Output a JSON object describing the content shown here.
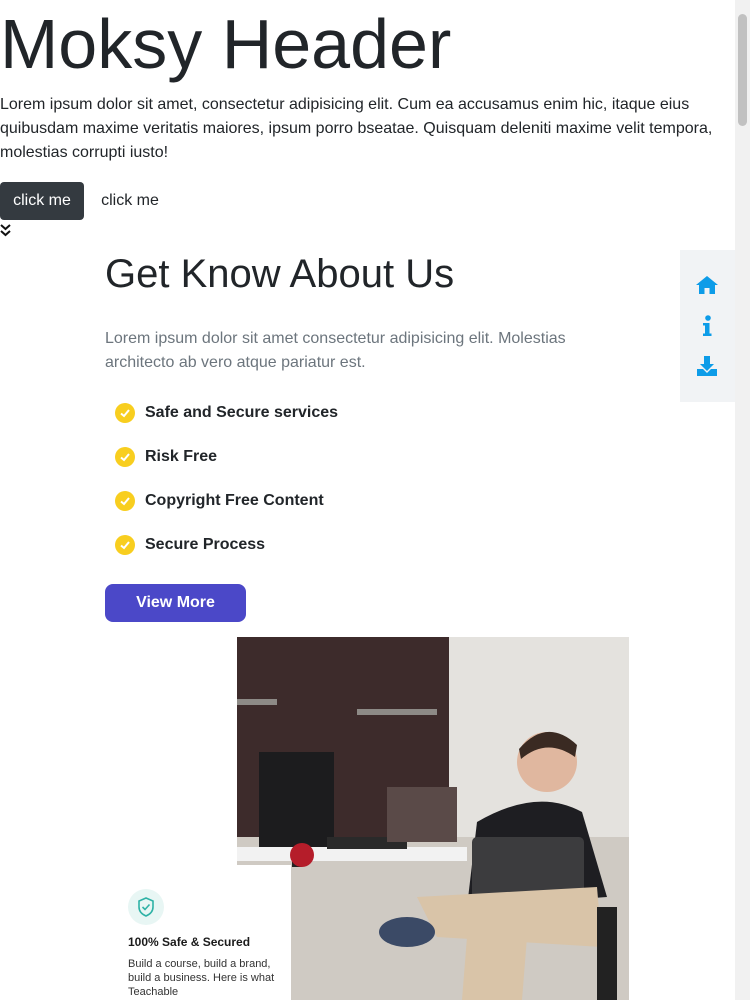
{
  "header": {
    "title": "Moksy Header",
    "text": "Lorem ipsum dolor sit amet, consectetur adipisicing elit. Cum ea accusamus enim hic, itaque eius quibusdam maxime veritatis maiores, ipsum porro bseatae. Quisquam deleniti maxime velit tempora, molestias corrupti iusto!",
    "primary_button": "click me",
    "secondary_button": "click me"
  },
  "about": {
    "title": "Get Know About Us",
    "text": "Lorem ipsum dolor sit amet consectetur adipisicing elit. Molestias architecto ab vero atque pariatur est.",
    "features": [
      "Safe and Secure services",
      "Risk Free",
      "Copyright Free Content",
      "Secure Process"
    ],
    "cta": "View More"
  },
  "card": {
    "title": "100% Safe & Secured",
    "text": "Build a course, build a brand, build a business. Here is what Teachable"
  },
  "side_nav": {
    "items": [
      "home-icon",
      "info-icon",
      "download-icon"
    ]
  },
  "colors": {
    "accent": "#4b48c8",
    "check": "#f8ce1f",
    "nav_icon": "#0d9ce8",
    "dark_button": "#343a40"
  }
}
